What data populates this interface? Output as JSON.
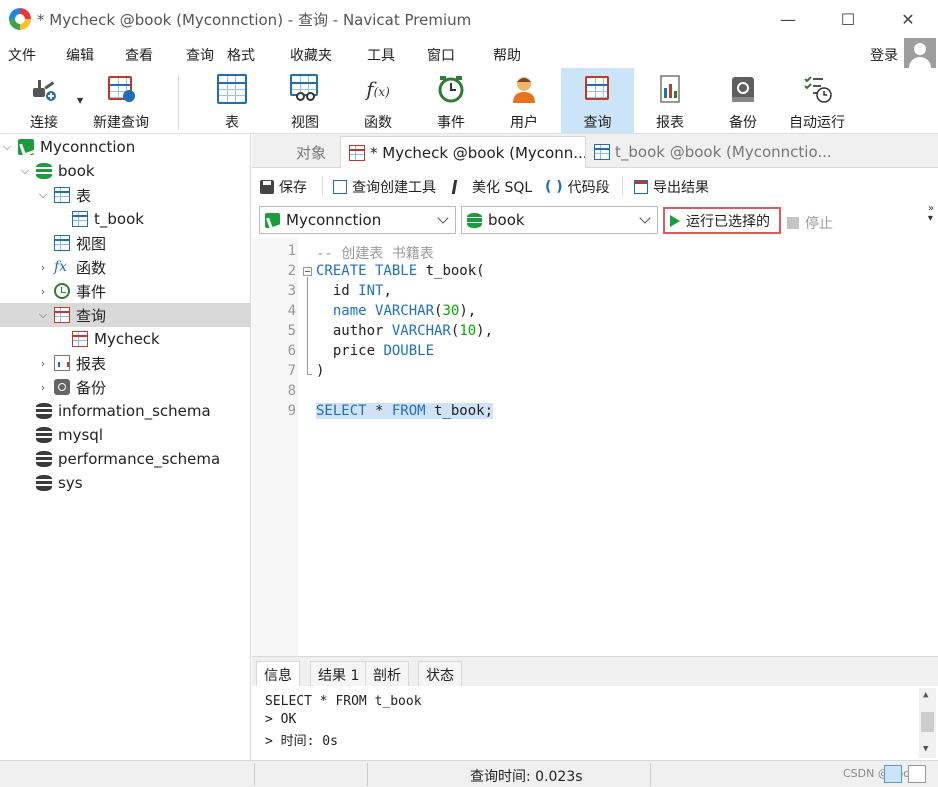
{
  "window": {
    "title": "* Mycheck @book (Myconnction) - 查询 - Navicat Premium",
    "controls": [
      "—",
      "☐",
      "✕"
    ]
  },
  "menu": {
    "items": [
      "文件",
      "编辑",
      "查看",
      "查询",
      "格式",
      "收藏夹",
      "工具",
      "窗口",
      "帮助"
    ],
    "login": "登录"
  },
  "toolbar": {
    "items": [
      "连接",
      "新建查询",
      "表",
      "视图",
      "函数",
      "事件",
      "用户",
      "查询",
      "报表",
      "备份",
      "自动运行"
    ],
    "active": "查询"
  },
  "tree": {
    "connection": "Myconnction",
    "database": "book",
    "tables_label": "表",
    "table": "t_book",
    "views_label": "视图",
    "functions_label": "函数",
    "events_label": "事件",
    "queries_label": "查询",
    "query": "Mycheck",
    "reports_label": "报表",
    "backups_label": "备份",
    "other_dbs": [
      "information_schema",
      "mysql",
      "performance_schema",
      "sys"
    ]
  },
  "tabs": {
    "objects": "对象",
    "query_tab": "* Mycheck @book (Myconn...",
    "table_tab": "t_book @book (Myconnctio..."
  },
  "editor_toolbar": {
    "save": "保存",
    "builder": "查询创建工具",
    "beautify": "美化 SQL",
    "snippet": "代码段",
    "export": "导出结果"
  },
  "selectors": {
    "connection": "Myconnction",
    "database": "book",
    "run_selected": "运行已选择的",
    "stop": "停止"
  },
  "code": {
    "line_numbers": [
      "1",
      "2",
      "3",
      "4",
      "5",
      "6",
      "7",
      "8",
      "9"
    ],
    "lines": {
      "l1": "-- 创建表 书籍表",
      "l2_kw": "CREATE TABLE",
      "l2_rest": " t_book(",
      "l3_name": "  id ",
      "l3_type": "INT",
      "l3_end": ",",
      "l4_name": "  name ",
      "l4_type": "VARCHAR",
      "l4_open": "(",
      "l4_num": "30",
      "l4_close": "),",
      "l5_name": "  author ",
      "l5_type": "VARCHAR",
      "l5_open": "(",
      "l5_num": "10",
      "l5_close": "),",
      "l6_name": "  price ",
      "l6_type": "DOUBLE",
      "l7": ")",
      "l9_kw1": "SELECT",
      "l9_mid": " * ",
      "l9_kw2": "FROM",
      "l9_rest": " t_book;"
    }
  },
  "result_tabs": [
    "信息",
    "结果 1",
    "剖析",
    "状态"
  ],
  "info": {
    "line1": "SELECT * FROM t_book",
    "line2": "> OK",
    "line3": "> 时间: 0s"
  },
  "status": {
    "query_time": "查询时间: 0.023s",
    "watermark": "CSDN @Code"
  },
  "colors": {
    "accent": "#1f6fb5",
    "highlight_box": "#e05a5a",
    "keyword": "#1f6fbf",
    "number": "#0aa20a",
    "selection": "#cfe2f8"
  }
}
